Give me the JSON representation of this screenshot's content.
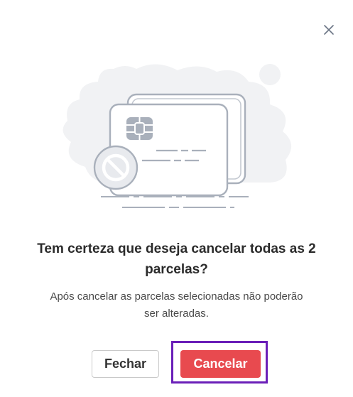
{
  "dialog": {
    "title": "Tem certeza que deseja cancelar todas as 2 parcelas?",
    "message": "Após cancelar as parcelas selecionadas não poderão ser alteradas.",
    "close_icon": "close-icon",
    "illustration_icon": "blocked-credit-card-illustration"
  },
  "buttons": {
    "close_label": "Fechar",
    "cancel_label": "Cancelar"
  },
  "colors": {
    "primary_danger": "#e84a4f",
    "focus_ring": "#6a1fb8",
    "title_text": "#2b2b2b",
    "body_text": "#4a4a4a",
    "illustration_stroke": "#a9b0bb",
    "illustration_bg": "#f1f2f4"
  }
}
